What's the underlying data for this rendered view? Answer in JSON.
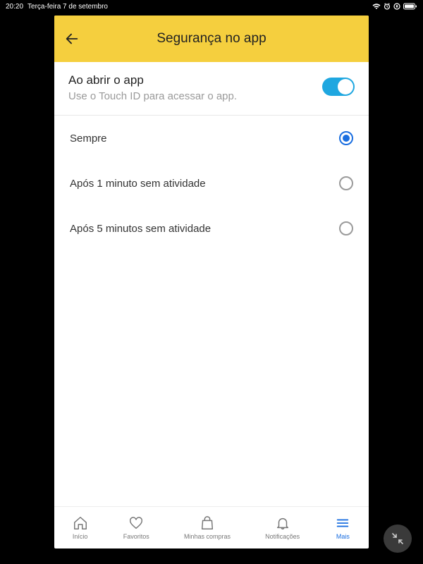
{
  "status": {
    "time": "20:20",
    "date": "Terça-feira 7 de setembro"
  },
  "header": {
    "title": "Segurança no app"
  },
  "section": {
    "title": "Ao abrir o app",
    "subtitle": "Use o Touch ID para acessar o app."
  },
  "options": [
    {
      "label": "Sempre",
      "selected": true
    },
    {
      "label": "Após 1 minuto sem atividade",
      "selected": false
    },
    {
      "label": "Após 5 minutos sem atividade",
      "selected": false
    }
  ],
  "nav": {
    "items": [
      {
        "label": "Início"
      },
      {
        "label": "Favoritos"
      },
      {
        "label": "Minhas compras"
      },
      {
        "label": "Notificações"
      },
      {
        "label": "Mais"
      }
    ]
  }
}
